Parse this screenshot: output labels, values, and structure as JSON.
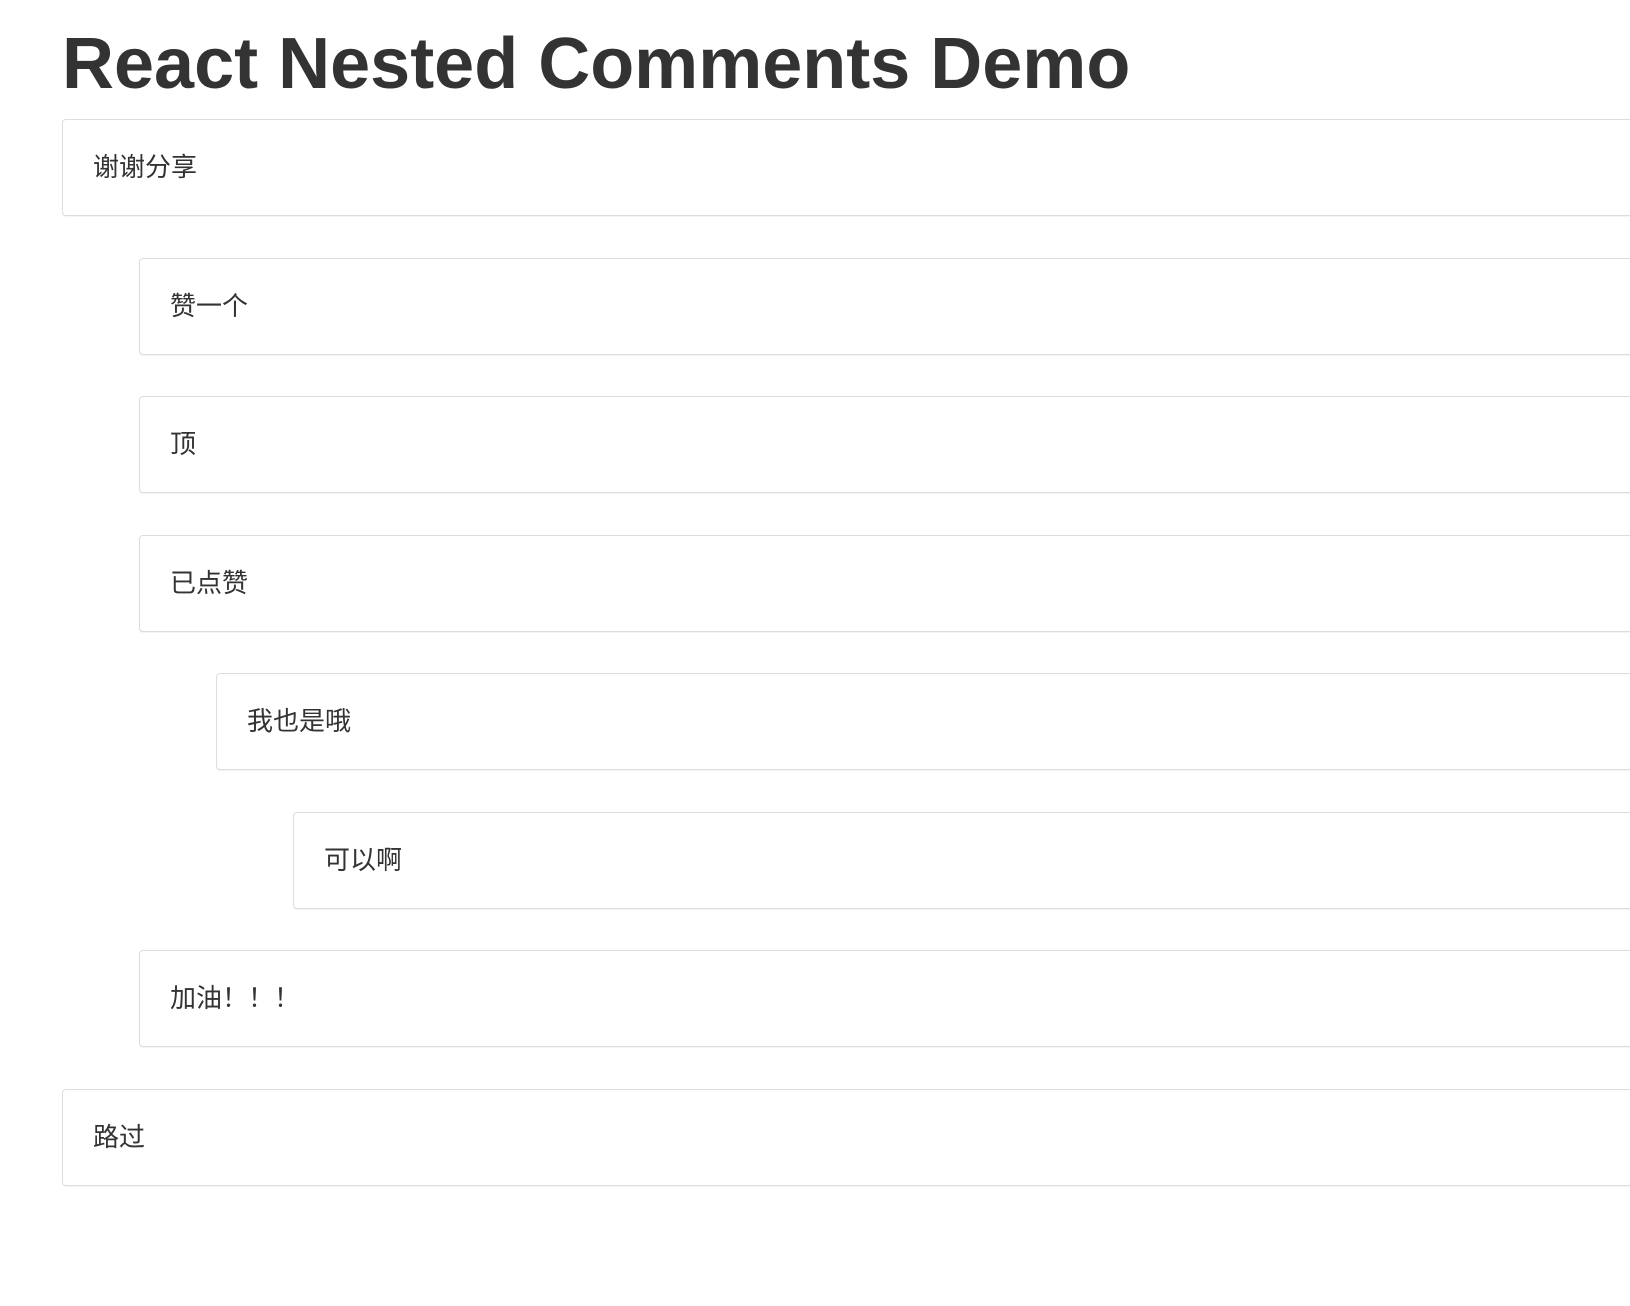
{
  "page": {
    "title": "React Nested Comments Demo"
  },
  "comments": [
    {
      "depth": 0,
      "text": "谢谢分享"
    },
    {
      "depth": 1,
      "text": "赞一个"
    },
    {
      "depth": 1,
      "text": "顶"
    },
    {
      "depth": 1,
      "text": "已点赞"
    },
    {
      "depth": 2,
      "text": "我也是哦"
    },
    {
      "depth": 3,
      "text": "可以啊"
    },
    {
      "depth": 1,
      "text": "加油！！！"
    },
    {
      "depth": 0,
      "text": "路过"
    }
  ],
  "colors": {
    "text": "#333333",
    "border": "#dddddd",
    "background": "#ffffff"
  }
}
